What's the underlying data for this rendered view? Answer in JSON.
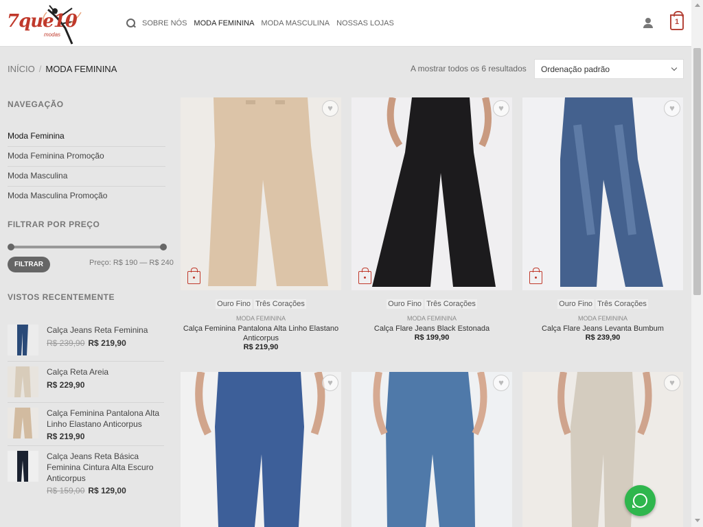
{
  "header": {
    "logo_text": "7que10",
    "logo_sub": "modas",
    "nav": [
      "SOBRE NÓS",
      "MODA FEMININA",
      "MODA MASCULINA",
      "NOSSAS LOJAS"
    ],
    "cart_count": "1"
  },
  "breadcrumb": {
    "home": "INÍCIO",
    "separator": "/",
    "current": "MODA FEMININA"
  },
  "results": "A mostrar todos os 6 resultados",
  "sort": {
    "selected": "Ordenação padrão"
  },
  "sidebar": {
    "nav_title": "NAVEGAÇÃO",
    "nav_items": [
      "Moda Feminina",
      "Moda Feminina Promoção",
      "Moda Masculina",
      "Moda Masculina Promoção"
    ],
    "filter_title": "FILTRAR POR PREÇO",
    "filter_button": "FILTRAR",
    "price_range": "Preço: R$ 190 — R$ 240",
    "price_slider": {
      "min": 190,
      "max": 240
    },
    "recent_title": "VISTOS RECENTEMENTE",
    "recent": [
      {
        "name": "Calça Jeans Reta Feminina",
        "old_price": "R$ 239,90",
        "price": "R$ 219,90"
      },
      {
        "name": "Calça Reta Areia",
        "old_price": "",
        "price": "R$ 229,90"
      },
      {
        "name": "Calça Feminina Pantalona Alta Linho Elastano Anticorpus",
        "old_price": "",
        "price": "R$ 219,90"
      },
      {
        "name": "Calça Jeans Reta Básica Feminina Cintura Alta Escuro Anticorpus",
        "old_price": "R$ 159,00",
        "price": "R$ 129,00"
      }
    ]
  },
  "products": [
    {
      "tags": [
        "Ouro Fino",
        "Três Corações"
      ],
      "category": "MODA FEMININA",
      "name": "Calça Feminina Pantalona Alta Linho Elastano Anticorpus",
      "price": "R$ 219,90"
    },
    {
      "tags": [
        "Ouro Fino",
        "Três Corações"
      ],
      "category": "MODA FEMININA",
      "name": "Calça Flare Jeans Black Estonada",
      "price": "R$ 199,90"
    },
    {
      "tags": [
        "Ouro Fino",
        "Três Corações"
      ],
      "category": "MODA FEMININA",
      "name": "Calça Flare Jeans Levanta Bumbum",
      "price": "R$ 239,90"
    }
  ],
  "colors": {
    "accent": "#b5453a",
    "whatsapp": "#2fb64d",
    "background": "#e6e6e6"
  }
}
